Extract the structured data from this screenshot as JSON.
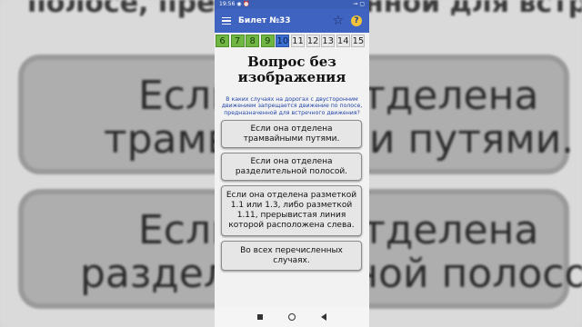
{
  "background": {
    "top_text": "полосе, предназначенной для встречного",
    "cards": [
      {
        "line1": "Если она отделена",
        "line2": "трамвайными путями."
      },
      {
        "line1": "Если она отделена",
        "line2": "разделительной полосой."
      }
    ]
  },
  "status_bar": {
    "time": "19:56",
    "icons": "◉ ⏰",
    "right": "⊸ ▢"
  },
  "app_bar": {
    "title": "Билет №33",
    "star_icon": "star-outline-icon",
    "help_label": "?"
  },
  "tabs": [
    "6",
    "7",
    "8",
    "9",
    "10",
    "11",
    "12",
    "13",
    "14",
    "15"
  ],
  "tab_states": [
    "done",
    "done",
    "done",
    "done",
    "current",
    "",
    "",
    "",
    "",
    ""
  ],
  "question": {
    "heading": "Вопрос без изображения",
    "text": "В каких случаях на дорогах с двусторонним движением запрещается движение по полосе, предназначенной для встречного движения?"
  },
  "answers": [
    "Если она отделена трамвайными путями.",
    "Если она отделена разделительной полосой.",
    "Если она отделена разметкой 1.1 или 1.3, либо разметкой 1.11, прерывистая линия которой расположена слева.",
    "Во всех перечисленных случаях."
  ],
  "colors": {
    "app_bar": "#3f63c0",
    "done_tab": "#6fb642",
    "current_tab": "#3b6fd1",
    "question_text": "#2447a8"
  }
}
